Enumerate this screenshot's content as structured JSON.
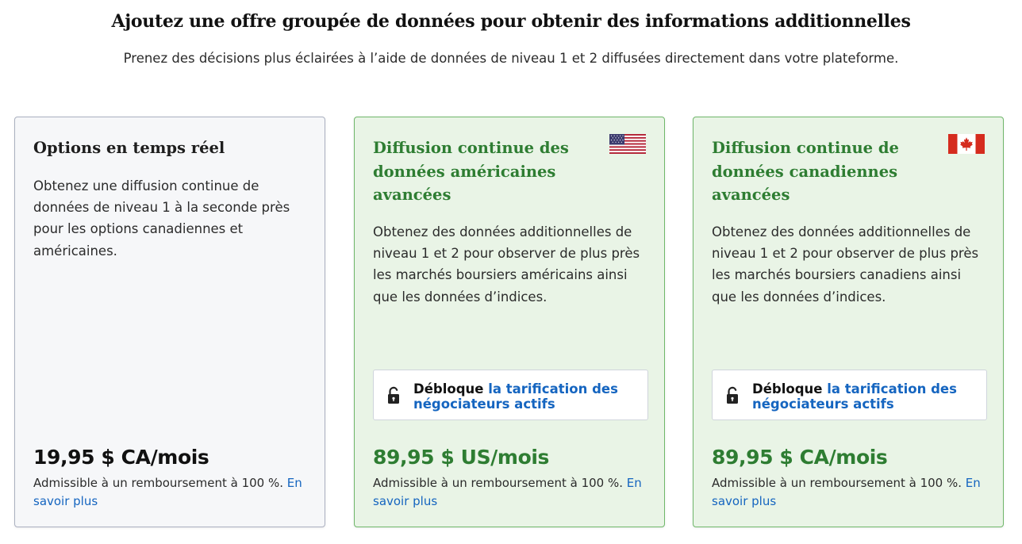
{
  "header": {
    "title": "Ajoutez une offre groupée de données pour obtenir des informations additionnelles",
    "subtitle": "Prenez des décisions plus éclairées à l’aide de données de niveau 1 et 2 diffusées directement dans votre plateforme."
  },
  "colors": {
    "accent_green": "#2e7d32",
    "link_blue": "#1565c0",
    "green_card_bg": "#e9f4e6",
    "gray_card_bg": "#f6f7f9"
  },
  "cards": [
    {
      "title": "Options en temps réel",
      "description": "Obtenez une diffusion continue de données de niveau 1 à la seconde près pour les options canadiennes et américaines.",
      "price": "19,95 $ CA/mois",
      "refund_text": "Admissible à un remboursement à 100 %.",
      "learn_more": "En savoir plus"
    },
    {
      "title": "Diffusion continue des données américaines avancées",
      "flag_icon": "us-flag-icon",
      "description": "Obtenez des données additionnelles de niveau 1 et 2 pour observer de plus près les marchés boursiers américains ainsi que les données d’indices.",
      "unlock_prefix": "Débloque",
      "unlock_link": "la tarification des négociateurs actifs",
      "unlock_icon": "unlock-icon",
      "price": "89,95 $ US/mois",
      "refund_text": "Admissible à un remboursement à 100 %.",
      "learn_more": "En savoir plus"
    },
    {
      "title": "Diffusion continue de données canadiennes avancées",
      "flag_icon": "canada-flag-icon",
      "description": "Obtenez des données additionnelles de niveau 1 et 2 pour observer de plus près les marchés boursiers canadiens ainsi que les données d’indices.",
      "unlock_prefix": "Débloque",
      "unlock_link": "la tarification des négociateurs actifs",
      "unlock_icon": "unlock-icon",
      "price": "89,95 $ CA/mois",
      "refund_text": "Admissible à un remboursement à 100 %.",
      "learn_more": "En savoir plus"
    }
  ]
}
